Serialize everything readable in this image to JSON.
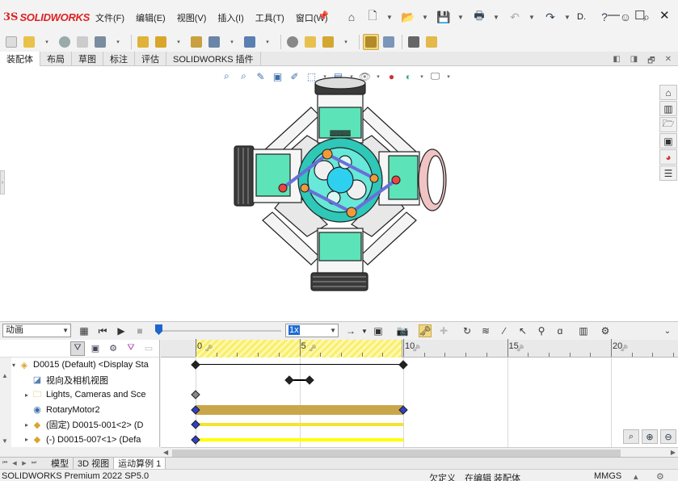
{
  "app": {
    "logo_prefix": "3S",
    "logo_name": "SOLIDWORKS"
  },
  "menu": [
    "文件(F)",
    "编辑(E)",
    "视图(V)",
    "插入(I)",
    "工具(T)",
    "窗口(W)"
  ],
  "toolbar_icons": [
    "home-icon",
    "new-document-icon",
    "open-icon",
    "save-icon",
    "print-icon",
    "undo-icon",
    "rebuild-icon",
    "help-icon",
    "user-icon",
    "search-icon"
  ],
  "quick_truncated": "D.",
  "command_tabs": [
    "装配体",
    "布局",
    "草图",
    "标注",
    "评估",
    "SOLIDWORKS 插件"
  ],
  "active_tab": 0,
  "motion": {
    "study_type": "动画",
    "speed": "1x",
    "timeline_ticks": [
      {
        "label": "0",
        "t": 0
      },
      {
        "label": "5",
        "t": 5
      },
      {
        "label": "10",
        "t": 10
      },
      {
        "label": "15",
        "t": 15
      },
      {
        "label": "20",
        "t": 20
      }
    ],
    "tree": [
      {
        "label": "D0015 (Default) <Display Sta",
        "icon": "assembly-icon",
        "expand": "▾",
        "indent": 22
      },
      {
        "label": "视向及相机视图",
        "icon": "camera-view-icon",
        "expand": "",
        "indent": 38
      },
      {
        "label": "Lights, Cameras and Sce",
        "icon": "lights-folder-icon",
        "expand": "▸",
        "indent": 38
      },
      {
        "label": "RotaryMotor2",
        "icon": "rotary-motor-icon",
        "expand": "",
        "indent": 38
      },
      {
        "label": "(固定) D0015-001<2> (D",
        "icon": "part-icon",
        "expand": "▸",
        "indent": 38
      },
      {
        "label": "(-) D0015-007<1> (Defa",
        "icon": "part-icon",
        "expand": "▸",
        "indent": 38
      }
    ],
    "tracks": [
      {
        "type": "line",
        "start": 0,
        "end": 10,
        "color": "#000000"
      },
      {
        "type": "line",
        "start": 4.5,
        "end": 5.5,
        "color": "#000000"
      },
      {
        "type": "key",
        "start": 0,
        "color": "#888888"
      },
      {
        "type": "bar",
        "start": 0,
        "end": 10,
        "color": "#c9a64a"
      },
      {
        "type": "thin",
        "start": 0,
        "end": 10,
        "color": "#f2e431"
      },
      {
        "type": "thin",
        "start": 0,
        "end": 10,
        "color": "#ffff00"
      }
    ]
  },
  "bottom_tabs": [
    "模型",
    "3D 视图",
    "运动算例 1"
  ],
  "active_bottom_tab": 2,
  "status": {
    "product": "SOLIDWORKS Premium 2022 SP5.0",
    "define": "欠定义",
    "editing": "在编辑 装配体",
    "units": "MMGS"
  }
}
